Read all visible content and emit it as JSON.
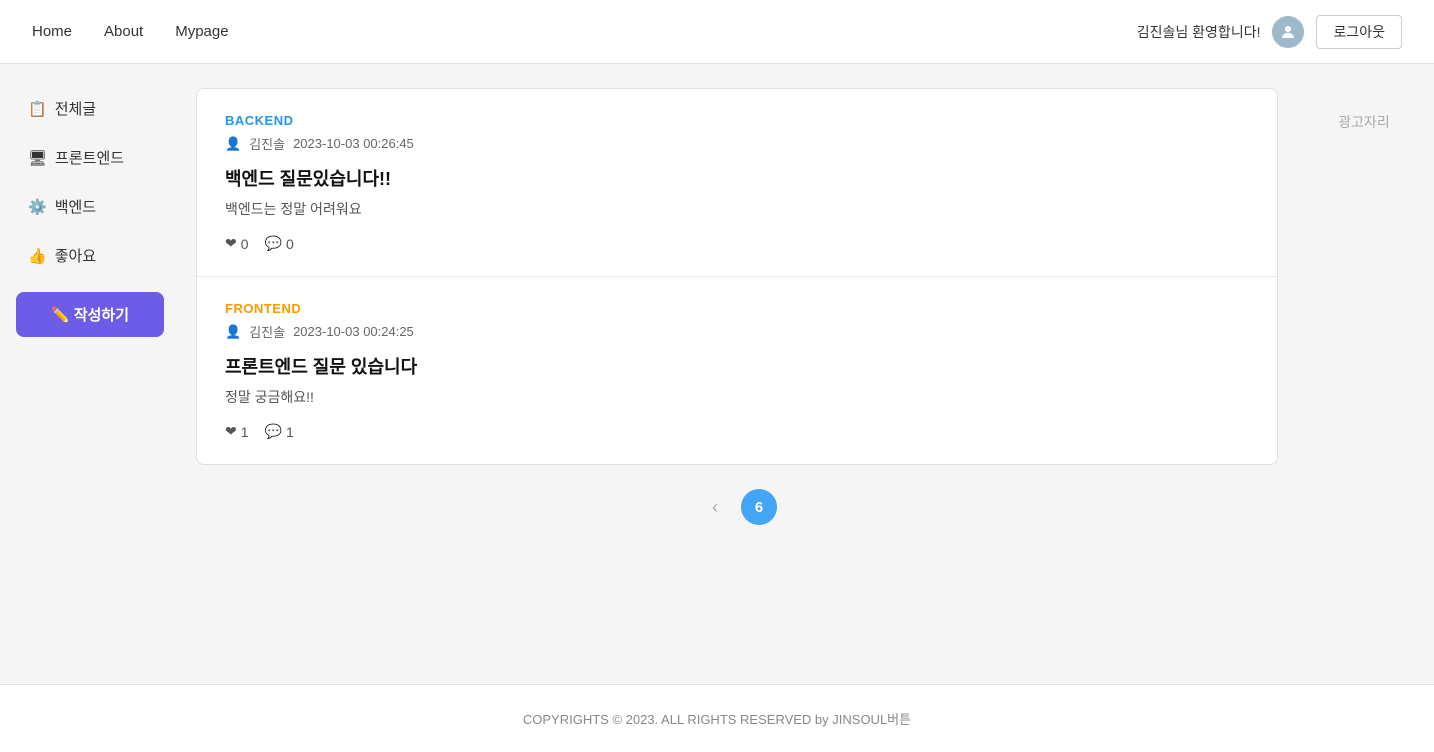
{
  "header": {
    "nav": [
      {
        "label": "Home",
        "id": "home"
      },
      {
        "label": "About",
        "id": "about"
      },
      {
        "label": "Mypage",
        "id": "mypage"
      }
    ],
    "welcome": "김진솔님 환영합니다!",
    "logout_label": "로그아웃"
  },
  "sidebar": {
    "items": [
      {
        "icon": "📋",
        "label": "전체글",
        "id": "all"
      },
      {
        "icon": "🖥",
        "label": "프론트엔드",
        "id": "frontend"
      },
      {
        "icon": "⚙️",
        "label": "백엔드",
        "id": "backend"
      },
      {
        "icon": "👍",
        "label": "좋아요",
        "id": "likes"
      }
    ],
    "write_btn": "✏️ 작성하기"
  },
  "posts": [
    {
      "category": "BACKEND",
      "category_type": "backend",
      "author": "김진솔",
      "date": "2023-10-03 00:26:45",
      "title": "백엔드 질문있습니다!!",
      "excerpt": "백엔드는 정말 어려워요",
      "likes": 0,
      "comments": 0
    },
    {
      "category": "FRONTEND",
      "category_type": "frontend",
      "author": "김진솔",
      "date": "2023-10-03 00:24:25",
      "title": "프론트엔드 질문 있습니다",
      "excerpt": "정말 궁금해요!!",
      "likes": 1,
      "comments": 1
    }
  ],
  "pagination": {
    "prev_label": "‹",
    "current_page": 6
  },
  "ad": {
    "label": "광고자리"
  },
  "footer": {
    "text": "COPYRIGHTS © 2023. ALL RIGHTS RESERVED by JINSOUL버튼"
  }
}
